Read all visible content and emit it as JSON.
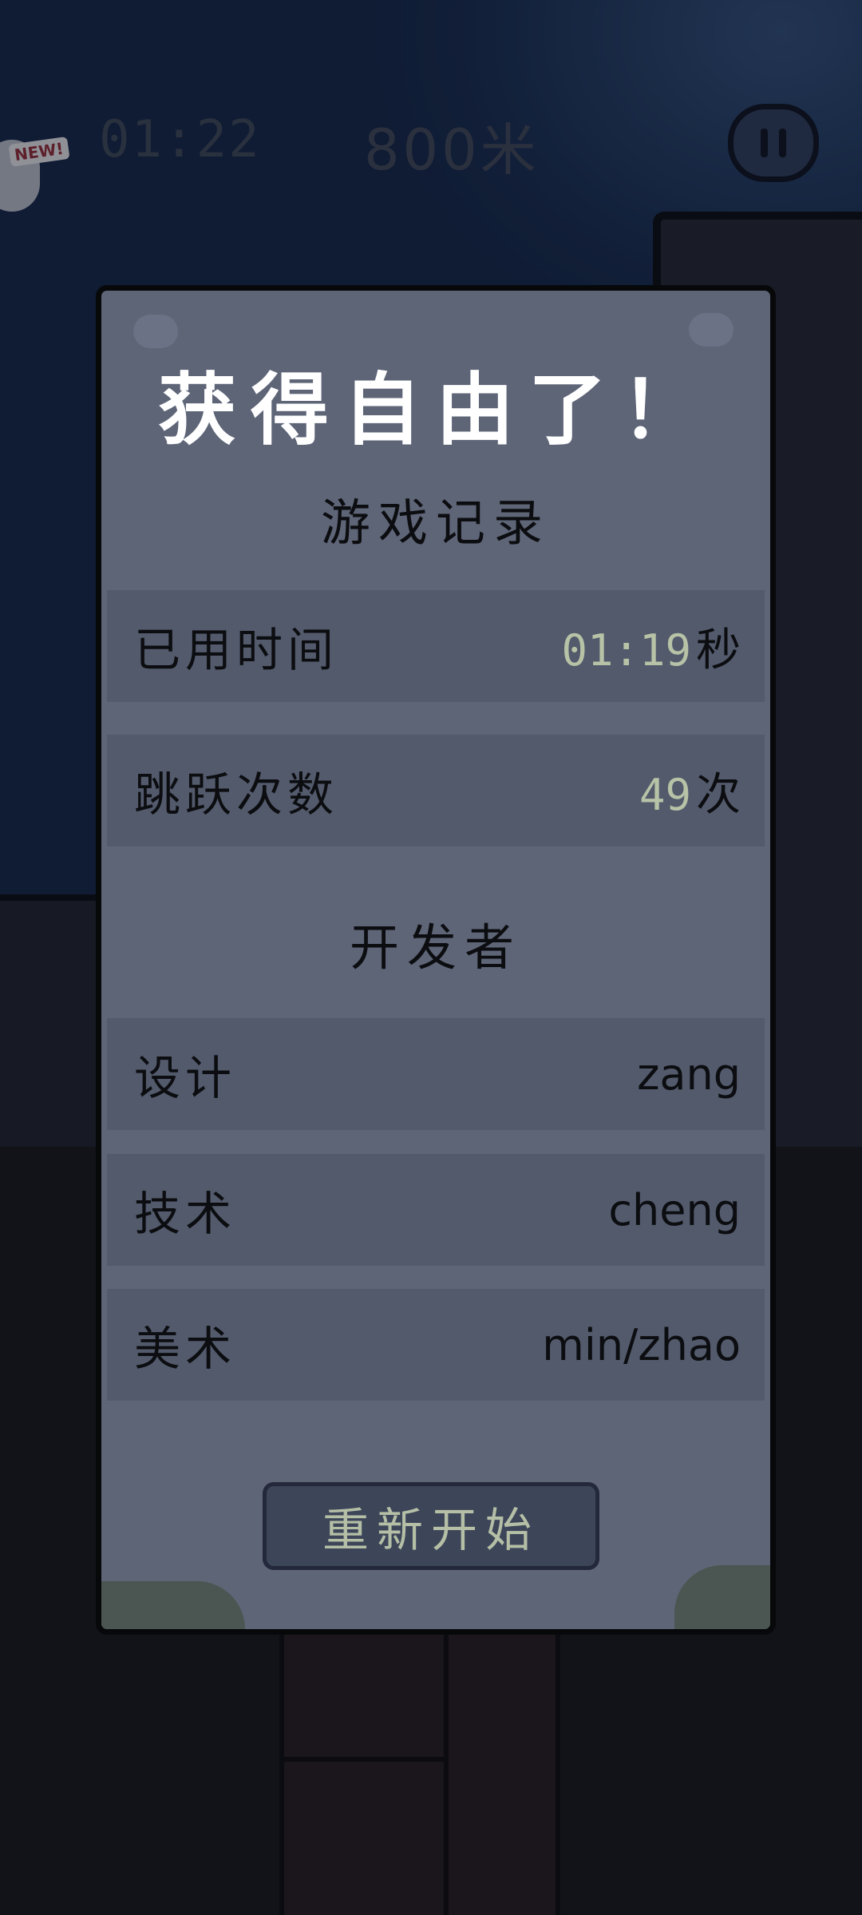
{
  "hud": {
    "time": "01:22",
    "distance": "800米",
    "new_badge": "NEW!",
    "pause_icon": "pause-icon"
  },
  "dialog": {
    "title": "获得自由了！",
    "record_header": "游戏记录",
    "stats": [
      {
        "label": "已用时间",
        "value": "01:19",
        "unit": "秒"
      },
      {
        "label": "跳跃次数",
        "value": "49",
        "unit": "次"
      }
    ],
    "dev_header": "开发者",
    "credits": [
      {
        "label": "设计",
        "value": "zang"
      },
      {
        "label": "技术",
        "value": "cheng"
      },
      {
        "label": "美术",
        "value": "min/zhao"
      }
    ],
    "restart_label": "重新开始"
  },
  "colors": {
    "panel": "#5e6577",
    "row_dark": "#525a6c",
    "stat_value": "#b7c2a6",
    "title_text": "#ffffff"
  }
}
